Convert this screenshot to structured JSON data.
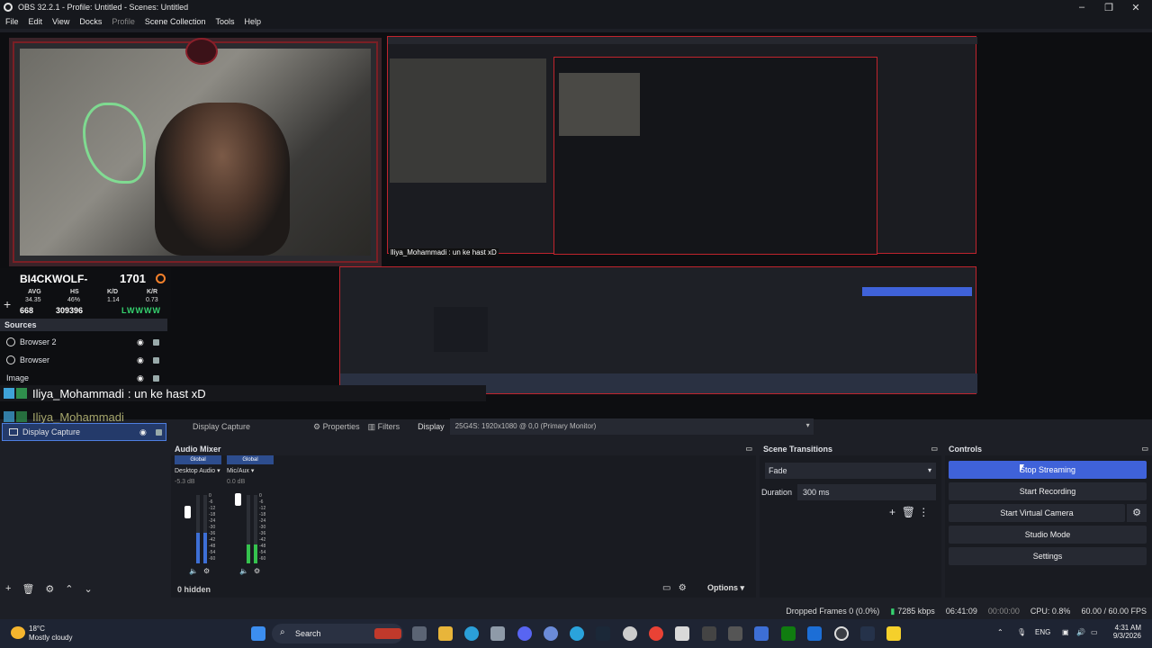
{
  "window": {
    "title": "OBS 32.2.1 - Profile: Untitled - Scenes: Untitled"
  },
  "menu": [
    "File",
    "Edit",
    "View",
    "Docks",
    "Profile",
    "Scene Collection",
    "Tools",
    "Help"
  ],
  "overlay": {
    "player_name": "BI4CKWOLF-",
    "elo": "1701",
    "headers": [
      "AVG",
      "HS",
      "K/D",
      "K/R"
    ],
    "values": [
      "34.35",
      "46%",
      "1.14",
      "0.73"
    ],
    "bottom_left": "668",
    "bottom_mid": "309396",
    "streak": "LWWWW"
  },
  "chat": {
    "user": "Iliya_Mohammadi",
    "message": ": un ke hast xD",
    "ghost_user": "Iliya_Mohammadi"
  },
  "sources": {
    "title": "Sources",
    "items": [
      {
        "label": "Browser 2"
      },
      {
        "label": "Browser"
      },
      {
        "label": "Image"
      },
      {
        "label": "Display Capture"
      }
    ]
  },
  "toolbar": {
    "source_name": "Display Capture",
    "properties": "Properties",
    "filters": "Filters",
    "display_label": "Display",
    "display_value": "25G4S: 1920x1080 @ 0,0 (Primary Monitor)"
  },
  "audio_mixer": {
    "title": "Audio Mixer",
    "channels": [
      {
        "global": "Global",
        "name": "Desktop Audio",
        "db": "-5.3 dB",
        "level": 0.45,
        "color": "#3d6fd6"
      },
      {
        "global": "Global",
        "name": "Mic/Aux",
        "db": "0.0 dB",
        "level": 0.28,
        "color": "#35c24e"
      }
    ],
    "scale": [
      "0",
      "-6",
      "-12",
      "-18",
      "-24",
      "-30",
      "-36",
      "-42",
      "-48",
      "-54",
      "-60"
    ],
    "hidden": "0 hidden",
    "options": "Options"
  },
  "scene_transitions": {
    "title": "Scene Transitions",
    "transition": "Fade",
    "duration_label": "Duration",
    "duration_value": "300 ms"
  },
  "controls": {
    "title": "Controls",
    "buttons": [
      "Stop Streaming",
      "Start Recording",
      "Start Virtual Camera",
      "Studio Mode",
      "Settings"
    ]
  },
  "status": {
    "dropped": "Dropped Frames 0 (0.0%)",
    "bitrate": "7285 kbps",
    "stream_time": "06:41:09",
    "rec_time": "00:00:00",
    "cpu": "CPU: 0.8%",
    "fps": "60.00 / 60.00 FPS"
  },
  "taskbar": {
    "temp": "18°C",
    "condition": "Mostly cloudy",
    "search": "Search",
    "lang": "ENG",
    "time": "4:31 AM",
    "date": "9/3/2026"
  }
}
